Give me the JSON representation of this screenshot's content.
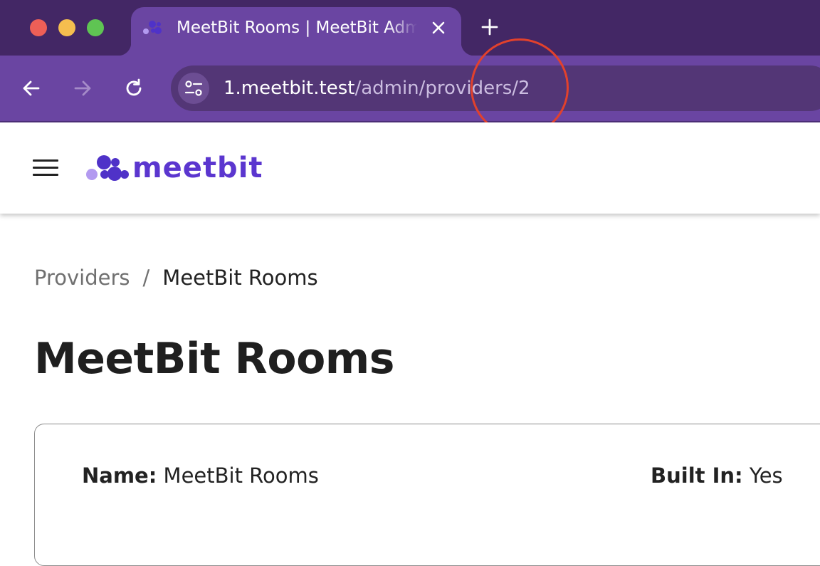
{
  "browser": {
    "tab": {
      "title": "MeetBit Rooms | MeetBit Admin"
    },
    "address_bar": {
      "host": "1.meetbit.test",
      "path": "/admin/providers/2"
    }
  },
  "app": {
    "brand": {
      "name": "meetbit",
      "color": "#5b36cf"
    }
  },
  "breadcrumb": {
    "parent": "Providers",
    "separator": "/",
    "current": "MeetBit Rooms"
  },
  "page": {
    "title": "MeetBit Rooms"
  },
  "details": {
    "name_label": "Name:",
    "name_value": "MeetBit Rooms",
    "built_in_label": "Built In:",
    "built_in_value": "Yes"
  },
  "colors": {
    "tabstrip": "#432765",
    "toolbar": "#6a45a2",
    "omnibox": "#533676",
    "annotation": "#e2412c"
  },
  "icons": [
    "favicon-icon",
    "close-icon",
    "plus-icon",
    "back-arrow-icon",
    "forward-arrow-icon",
    "reload-icon",
    "tune-icon",
    "hamburger-menu-icon",
    "meetbit-logo-icon"
  ]
}
